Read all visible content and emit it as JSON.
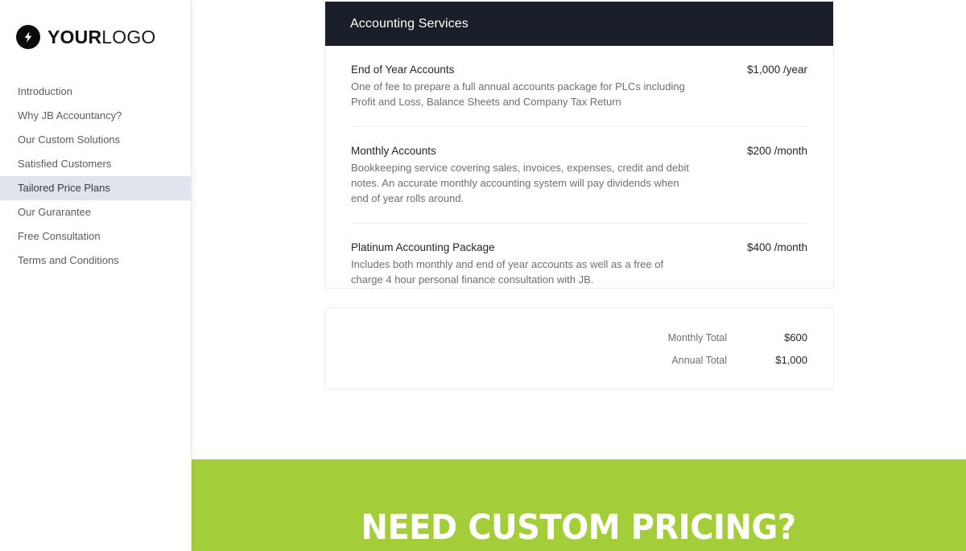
{
  "brand": {
    "icon": "lightning-bolt-icon",
    "name_strong": "YOUR",
    "name_light": "LOGO"
  },
  "sidebar": {
    "items": [
      {
        "label": "Introduction",
        "active": false
      },
      {
        "label": "Why JB Accountancy?",
        "active": false
      },
      {
        "label": "Our Custom Solutions",
        "active": false
      },
      {
        "label": "Satisfied Customers",
        "active": false
      },
      {
        "label": "Tailored Price Plans",
        "active": true
      },
      {
        "label": "Our Gurarantee",
        "active": false
      },
      {
        "label": "Free Consultation",
        "active": false
      },
      {
        "label": "Terms and Conditions",
        "active": false
      }
    ]
  },
  "services_card": {
    "header_title": "Accounting Services",
    "rows": [
      {
        "title": "End of Year Accounts",
        "description": "One of fee to prepare a full annual accounts package for PLCs including Profit and Loss, Balance Sheets and Company Tax Return",
        "price": "$1,000 /year"
      },
      {
        "title": "Monthly Accounts",
        "description": "Bookkeeping service covering sales, invoices, expenses, credit and debit notes. An accurate monthly accounting system will pay dividends when end of year rolls around.",
        "price": "$200 /month"
      },
      {
        "title": "Platinum Accounting Package",
        "description": "Includes both monthly and end of year accounts as well as a free of charge 4 hour personal finance consultation with JB.",
        "price": "$400 /month"
      }
    ]
  },
  "totals_card": {
    "rows": [
      {
        "label": "Monthly Total",
        "value": "$600"
      },
      {
        "label": "Annual Total",
        "value": "$1,000"
      }
    ]
  },
  "banner": {
    "title": "NEED CUSTOM PRICING?",
    "background_color": "#a4ce39"
  },
  "colors": {
    "header_dark": "#191e28",
    "accent_green": "#a4ce39",
    "active_nav": "#dfe3eb"
  }
}
